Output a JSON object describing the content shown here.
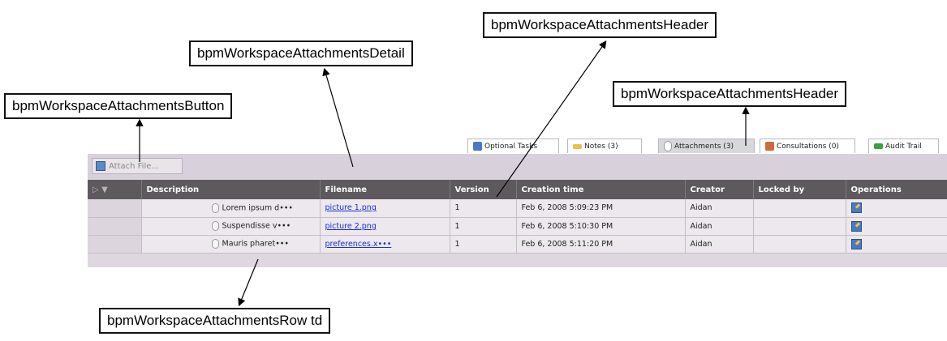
{
  "callouts": {
    "detail": "bpmWorkspaceAttachmentsDetail",
    "header_top": "bpmWorkspaceAttachmentsHeader",
    "header_right": "bpmWorkspaceAttachmentsHeader",
    "button": "bpmWorkspaceAttachmentsButton",
    "row_td": "bpmWorkspaceAttachmentsRow td"
  },
  "tabs": [
    {
      "label": "Optional Tasks",
      "icon": "play-icon",
      "color": "#4a78c8"
    },
    {
      "label": "Notes (3)",
      "icon": "note-icon",
      "color": "#e8c04a"
    },
    {
      "label": "Attachments (3)",
      "icon": "paperclip-icon",
      "color": "#999999"
    },
    {
      "label": "Consultations (0)",
      "icon": "people-icon",
      "color": "#d06a3a"
    },
    {
      "label": "Audit Trail",
      "icon": "audit-trail-icon",
      "color": "#3aa040"
    }
  ],
  "toolbar": {
    "attach_label": "Attach File..."
  },
  "table": {
    "headers": [
      "Description",
      "Filename",
      "Version",
      "Creation time",
      "Creator",
      "Locked by",
      "Operations"
    ],
    "rows": [
      {
        "description": "Lorem ipsum d•••",
        "filename": "picture 1.png",
        "version": "1",
        "created": "Feb 6, 2008 5:09:23 PM",
        "creator": "Aidan",
        "locked_by": ""
      },
      {
        "description": "Suspendisse v•••",
        "filename": "picture 2.png",
        "version": "1",
        "created": "Feb 6, 2008 5:10:30 PM",
        "creator": "Aidan",
        "locked_by": ""
      },
      {
        "description": "Mauris pharet•••",
        "filename": "preferences.x•••",
        "version": "1",
        "created": "Feb 6, 2008 5:11:20 PM",
        "creator": "Aidan",
        "locked_by": ""
      }
    ]
  },
  "colors": {
    "header_bg": "#5e595f",
    "panel_bg": "#ded7e0",
    "link": "#1a2fd8"
  }
}
